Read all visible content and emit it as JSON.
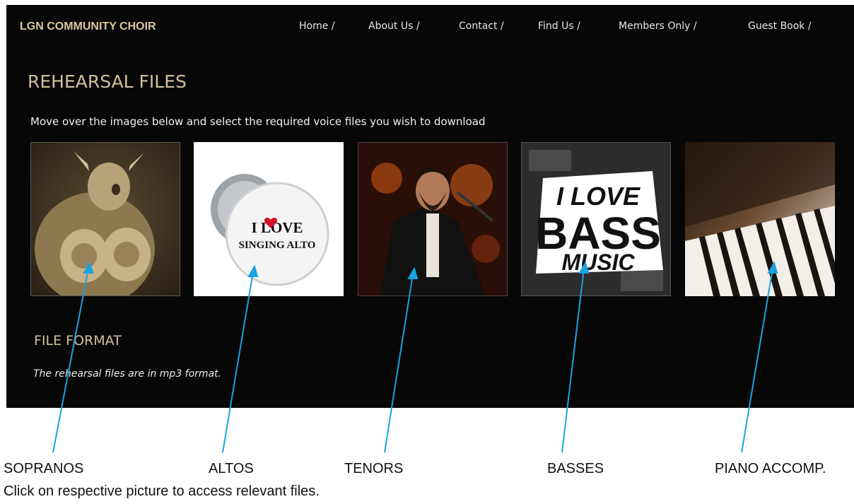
{
  "site": {
    "brand": "LGN COMMUNITY CHOIR",
    "nav": [
      "Home /",
      "About Us /",
      "Contact /",
      "Find Us /",
      "Members Only /",
      "Guest Book /"
    ]
  },
  "main": {
    "title": "REHEARSAL FILES",
    "instructions": "Move over the images below and select the required voice files you wish to download",
    "tiles": [
      {
        "name": "sopranos-image"
      },
      {
        "name": "altos-image",
        "badge_line1": "I LOVE",
        "badge_line2": "SINGING ALTO"
      },
      {
        "name": "tenors-image"
      },
      {
        "name": "basses-image",
        "line1": "I LOVE",
        "line2": "BASS",
        "line3": "MUSIC"
      },
      {
        "name": "piano-image"
      }
    ],
    "file_format": {
      "title": "FILE FORMAT",
      "text": "The rehearsal files are in mp3 format."
    }
  },
  "annotations": {
    "labels": [
      "SOPRANOS",
      "ALTOS",
      "TENORS",
      "BASSES",
      "PIANO ACCOMP."
    ],
    "footnote": "Click on respective picture to access relevant files.",
    "arrow_color": "#1aa3e0"
  }
}
